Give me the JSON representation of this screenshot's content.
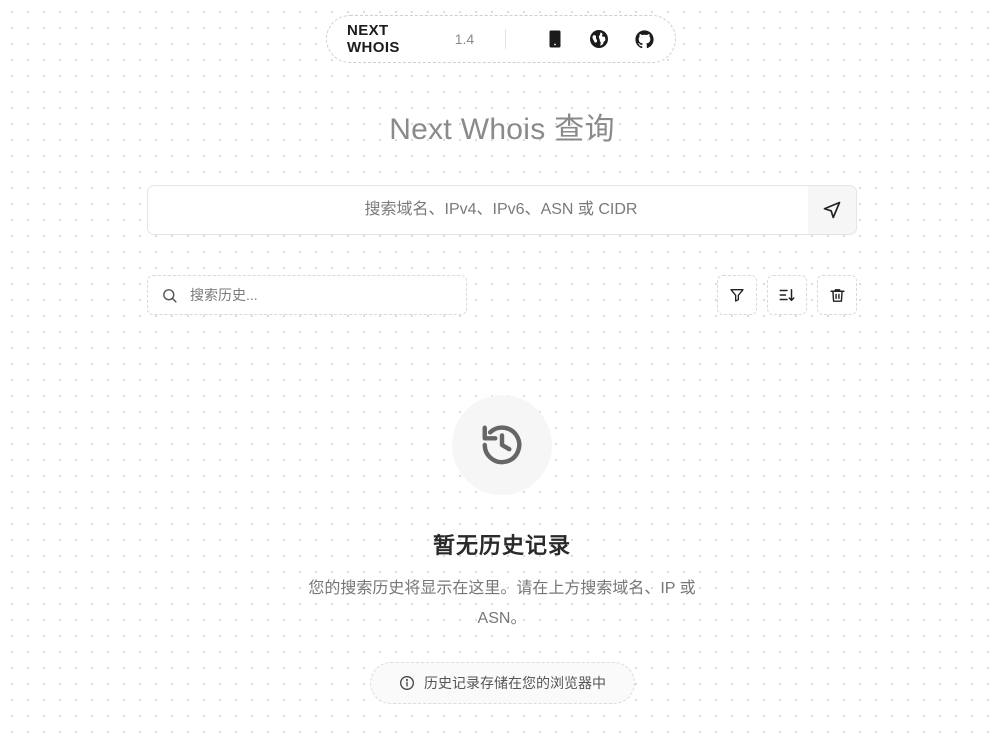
{
  "header": {
    "brand": "NEXT WHOIS",
    "version": "1.4",
    "icons": [
      "phone-icon",
      "globe-icon",
      "github-icon"
    ]
  },
  "title": "Next Whois 查询",
  "search": {
    "placeholder": "搜索域名、IPv4、IPv6、ASN 或 CIDR",
    "value": ""
  },
  "history": {
    "search_placeholder": "搜索历史...",
    "search_value": "",
    "toolbar_icons": [
      "filter-icon",
      "sort-icon",
      "trash-icon"
    ]
  },
  "empty_state": {
    "icon": "history-icon",
    "title": "暂无历史记录",
    "description": "您的搜索历史将显示在这里。请在上方搜索域名、IP 或 ASN。",
    "note": "历史记录存储在您的浏览器中"
  }
}
